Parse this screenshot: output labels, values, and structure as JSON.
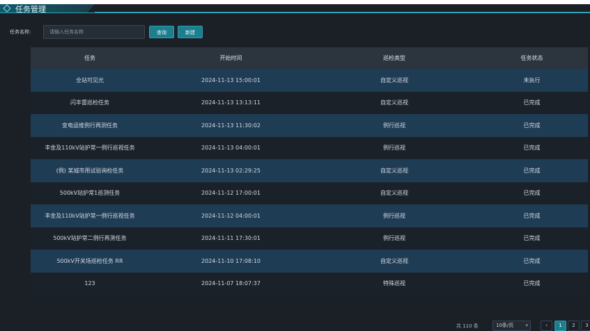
{
  "window": {
    "title": "任务管理"
  },
  "search": {
    "label": "任务名称:",
    "placeholder": "请输入任务名称",
    "query_label": "查询",
    "new_label": "新建"
  },
  "table": {
    "columns": [
      "任务",
      "开始时间",
      "巡检类型",
      "任务状态"
    ],
    "rows": [
      {
        "task": "全站可见光",
        "start": "2024-11-13 15:00:01",
        "type": "自定义巡视",
        "status": "未执行"
      },
      {
        "task": "闪丰雷巡检任务",
        "start": "2024-11-13 13:13:11",
        "type": "自定义巡视",
        "status": "已完成"
      },
      {
        "task": "变电运维例行再测任务",
        "start": "2024-11-13 11:30:02",
        "type": "例行巡视",
        "status": "已完成"
      },
      {
        "task": "丰金及110kV站护常一例行巡视任务",
        "start": "2024-11-13 04:00:01",
        "type": "例行巡视",
        "status": "已完成"
      },
      {
        "task": "(例) 某城市用试验询检任务",
        "start": "2024-11-13 02:29:25",
        "type": "自定义巡视",
        "status": "已完成"
      },
      {
        "task": "500kV站护常1巡测任务",
        "start": "2024-11-12 17:00:01",
        "type": "自定义巡视",
        "status": "已完成"
      },
      {
        "task": "丰金及110kV站护常一例行巡视任务",
        "start": "2024-11-12 04:00:01",
        "type": "例行巡视",
        "status": "已完成"
      },
      {
        "task": "500kV站护常二例行再测任务",
        "start": "2024-11-11 17:30:01",
        "type": "例行巡视",
        "status": "已完成"
      },
      {
        "task": "500kV开关场巡检任务 RR",
        "start": "2024-11-10 17:08:10",
        "type": "自定义巡视",
        "status": "已完成"
      },
      {
        "task": "123",
        "start": "2024-11-07 18:07:37",
        "type": "特殊巡视",
        "status": "已完成"
      }
    ]
  },
  "pagination": {
    "total": "共 110 条",
    "page_size": "10条/页",
    "prev": "‹",
    "pages": [
      "1",
      "2",
      "3"
    ]
  },
  "colors": {
    "accent": "#1d7f8e",
    "row_highlight": "#1f3c55",
    "background": "#1b2027"
  }
}
